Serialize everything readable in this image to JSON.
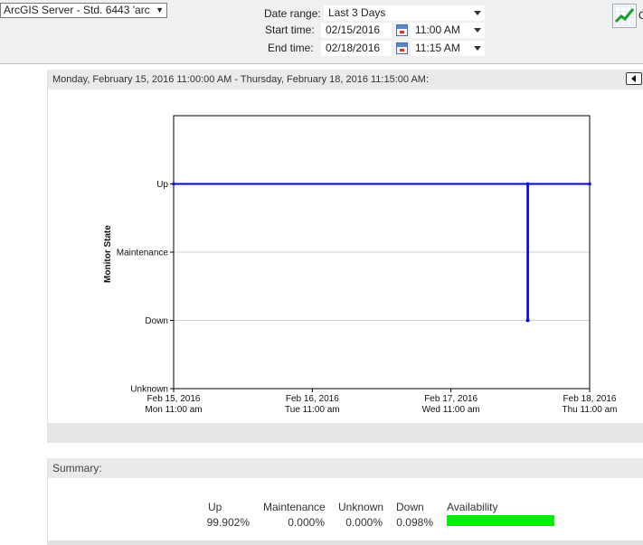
{
  "toolbar": {
    "monitor_select": "ArcGIS Server - Std. 6443 'arc",
    "date_range_label": "Date range:",
    "date_range_value": "Last 3 Days",
    "start_label": "Start time:",
    "start_date": "02/15/2016",
    "start_time": "11:00 AM",
    "end_label": "End time:",
    "end_date": "02/18/2016",
    "end_time": "11:15 AM",
    "cutoff_text": "C"
  },
  "panel": {
    "header": "Monday, February 15, 2016 11:00:00 AM - Thursday, February 18, 2016 11:15:00 AM:"
  },
  "chart_data": {
    "type": "line",
    "ylabel": "Monitor State",
    "y_categories": [
      "Unknown",
      "Down",
      "Maintenance",
      "Up"
    ],
    "x_ticks": [
      {
        "date": "Feb 15, 2016",
        "sub": "Mon 11:00 am"
      },
      {
        "date": "Feb 16, 2016",
        "sub": "Tue 11:00 am"
      },
      {
        "date": "Feb 17, 2016",
        "sub": "Wed 11:00 am"
      },
      {
        "date": "Feb 18, 2016",
        "sub": "Thu 11:00 am"
      }
    ],
    "xlim": [
      "2016-02-15 11:00",
      "2016-02-18 11:00"
    ],
    "grid": true,
    "series": [
      {
        "color": "#0000dd",
        "points": [
          {
            "x": "2016-02-15 11:00",
            "y": "Up"
          },
          {
            "x": "2016-02-18 00:15",
            "y": "Up"
          },
          {
            "x": "2016-02-18 00:15",
            "y": "Down"
          },
          {
            "x": "2016-02-18 00:20",
            "y": "Down"
          },
          {
            "x": "2016-02-18 00:20",
            "y": "Up"
          },
          {
            "x": "2016-02-18 11:00",
            "y": "Up"
          }
        ]
      }
    ]
  },
  "summary": {
    "title": "Summary:",
    "columns": [
      {
        "label": "Up",
        "value": "99.902%"
      },
      {
        "label": "Maintenance",
        "value": "0.000%"
      },
      {
        "label": "Unknown",
        "value": "0.000%"
      },
      {
        "label": "Down",
        "value": "0.098%"
      }
    ],
    "availability_label": "Availability",
    "availability_fraction": 0.99902,
    "availability_color": "#00ee00"
  }
}
